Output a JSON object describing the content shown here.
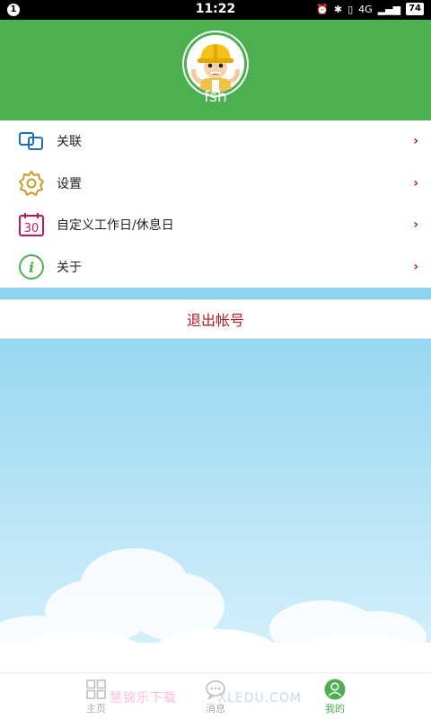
{
  "status_bar": {
    "notification_count": "1",
    "time": "11:22",
    "network": "4G",
    "battery": "74"
  },
  "profile": {
    "username": "fsh"
  },
  "menu": {
    "items": [
      {
        "label": "关联",
        "icon": "link-icon",
        "color": "#1e6fb5"
      },
      {
        "label": "设置",
        "icon": "gear-icon",
        "color": "#c89b2a"
      },
      {
        "label": "自定义工作日/休息日",
        "icon": "calendar-30-icon",
        "color": "#c2185b"
      },
      {
        "label": "关于",
        "icon": "info-icon",
        "color": "#4caf50"
      }
    ],
    "chevron": "›"
  },
  "logout_label": "退出帐号",
  "tabbar": {
    "home": "主页",
    "messages": "消息",
    "me": "我的"
  },
  "watermark": {
    "cn": "慧锦乐下载",
    "en": "XLEDU.COM"
  },
  "colors": {
    "header_green": "#4caf50",
    "accent_red": "#b71c1c",
    "sky_blue": "#8fd3f0"
  }
}
